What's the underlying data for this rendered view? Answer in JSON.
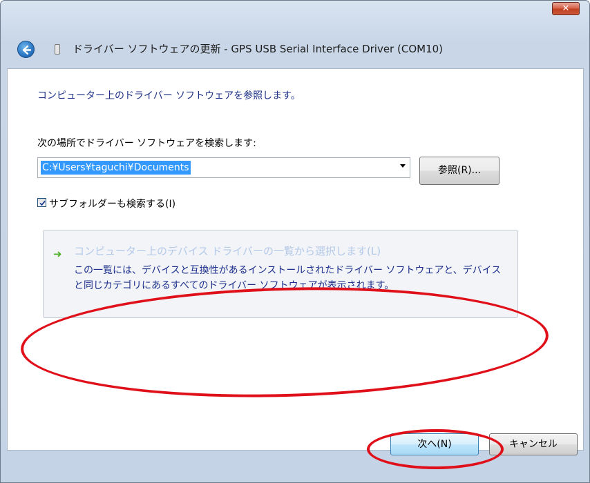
{
  "window": {
    "title": "ドライバー ソフトウェアの更新 - GPS USB Serial Interface Driver (COM10)",
    "close_label": "✕"
  },
  "content": {
    "heading": "コンピューター上のドライバー ソフトウェアを参照します。",
    "search_label": "次の場所でドライバー ソフトウェアを検索します:",
    "path_value": "C:¥Users¥taguchi¥Documents",
    "browse_label": "参照(R)...",
    "include_subfolders_label": "サブフォルダーも検索する(I)",
    "include_subfolders_checked": true
  },
  "pick_option": {
    "title": "コンピューター上のデバイス ドライバーの一覧から選択します(L)",
    "description": "この一覧には、デバイスと互換性があるインストールされたドライバー ソフトウェアと、デバイスと同じカテゴリにあるすべてのドライバー ソフトウェアが表示されます。"
  },
  "footer": {
    "next_label": "次へ(N)",
    "cancel_label": "キャンセル"
  },
  "colors": {
    "annotation": "#e0101a",
    "link": "#1c2e8c",
    "selection": "#3399ff"
  },
  "icons": {
    "back": "back-arrow-icon",
    "device": "usb-device-icon",
    "pick": "green-arrow-icon",
    "close": "close-icon"
  }
}
